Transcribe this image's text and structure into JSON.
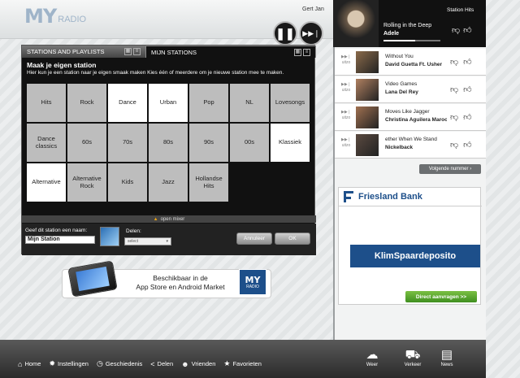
{
  "header": {
    "logo_my": "MY",
    "logo_radio": "RADIO",
    "user": "Gert Jan",
    "pause_icon": "pause-icon",
    "next_icon": "skip-next-icon"
  },
  "panel": {
    "tabs": [
      {
        "label": "STATIONS AND PLAYLISTS"
      },
      {
        "label": "MIJN STATIONS"
      }
    ],
    "title": "Maak je eigen station",
    "description": "Hier kun je een station naar je eigen smaak maken Kies één of meerdere om je nieuwe station mee te maken.",
    "genres": [
      {
        "label": "Hits",
        "selected": false
      },
      {
        "label": "Rock",
        "selected": false
      },
      {
        "label": "Dance",
        "selected": true
      },
      {
        "label": "Urban",
        "selected": true
      },
      {
        "label": "Pop",
        "selected": false
      },
      {
        "label": "NL",
        "selected": false
      },
      {
        "label": "Lovesongs",
        "selected": false
      },
      {
        "label": "Dance classics",
        "selected": false
      },
      {
        "label": "60s",
        "selected": false
      },
      {
        "label": "70s",
        "selected": false
      },
      {
        "label": "80s",
        "selected": false
      },
      {
        "label": "90s",
        "selected": false
      },
      {
        "label": "00s",
        "selected": false
      },
      {
        "label": "Klassiek",
        "selected": true
      },
      {
        "label": "Alternative",
        "selected": true
      },
      {
        "label": "Alternative Rock",
        "selected": false
      },
      {
        "label": "Kids",
        "selected": false
      },
      {
        "label": "Jazz",
        "selected": false
      },
      {
        "label": "Hollandse Hits",
        "selected": false
      }
    ],
    "open_mixer": "open mixer",
    "name_label": "Geef dit station een naam:",
    "name_value": "Mijn Station",
    "share_label": "Delen:",
    "share_select": "select",
    "cancel": "Annuleer",
    "ok": "OK"
  },
  "banner": {
    "line1": "Beschikbaar in de",
    "line2": "App Store en Android Market",
    "logo_my": "MY",
    "logo_radio": "RADIO"
  },
  "nav": [
    {
      "label": "Home",
      "icon": "home-icon",
      "glyph": "⌂"
    },
    {
      "label": "Instellingen",
      "icon": "gear-icon",
      "glyph": "✹"
    },
    {
      "label": "Geschiedenis",
      "icon": "clock-icon",
      "glyph": "◷"
    },
    {
      "label": "Delen",
      "icon": "share-icon",
      "glyph": "<"
    },
    {
      "label": "Vrienden",
      "icon": "friends-icon",
      "glyph": "☻"
    },
    {
      "label": "Favorieten",
      "icon": "star-icon",
      "glyph": "★"
    }
  ],
  "now_playing": {
    "station": "Station Hits",
    "title": "Rolling in the Deep",
    "artist": "Adele",
    "progress": 0.55
  },
  "tracks": [
    {
      "title": "Without You",
      "artist": "David Guetta Ft. Usher",
      "thumb_color": "#8a6a4a",
      "side": "uitzo"
    },
    {
      "title": "Video Games",
      "artist": "Lana Del Rey",
      "thumb_color": "#b08060",
      "side": "uitzo"
    },
    {
      "title": "Moves Like Jagger",
      "artist": "Christina Aguilera  Maroon",
      "thumb_color": "#a07050",
      "side": "uitzo"
    },
    {
      "title": "ether   When We Stand",
      "artist": "Nickelback",
      "thumb_color": "#5a4a40",
      "side": "uitzo"
    }
  ],
  "next_button": "Volgende nummer",
  "ad": {
    "brand": "Friesland Bank",
    "product": "KlimSpaardeposito",
    "cta": "Direct aanvragen  >>"
  },
  "right_nav": [
    {
      "label": "Weer",
      "icon": "weather-icon",
      "glyph": "☁"
    },
    {
      "label": "Verkeer",
      "icon": "car-icon",
      "glyph": "⛟"
    },
    {
      "label": "News",
      "icon": "news-icon",
      "glyph": "▤"
    }
  ]
}
